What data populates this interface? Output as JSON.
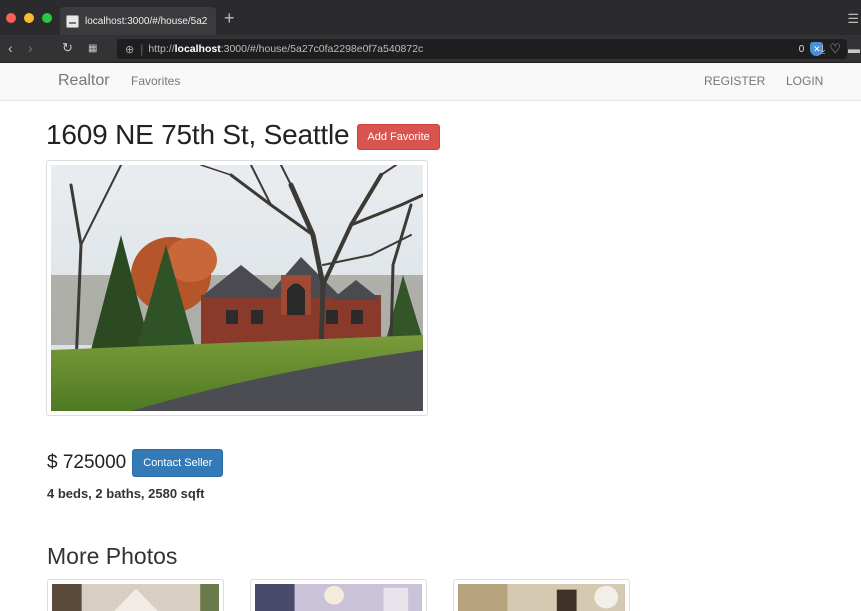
{
  "browser": {
    "tab_title": "localhost:3000/#/house/5a2",
    "url_prefix": "http://",
    "url_host": "localhost",
    "url_rest": ":3000/#/house/5a27c0fa2298e0f7a540872c",
    "badge_count": "0",
    "colors": {
      "close": "#fc5f57",
      "minimize": "#fdbc2e",
      "maximize": "#28c840"
    }
  },
  "navbar": {
    "brand": "Realtor",
    "favorites": "Favorites",
    "register": "REGISTER",
    "login": "LOGIN"
  },
  "house": {
    "address": "1609 NE 75th St, Seattle",
    "add_favorite": "Add Favorite",
    "price": "$ 725000",
    "contact_seller": "Contact Seller",
    "details": "4 beds, 2 baths, 2580 sqft"
  },
  "more_photos": {
    "title": "More Photos"
  },
  "colors": {
    "danger": "#d9534f",
    "primary": "#337ab7",
    "navbar_bg": "#f8f8f8"
  }
}
